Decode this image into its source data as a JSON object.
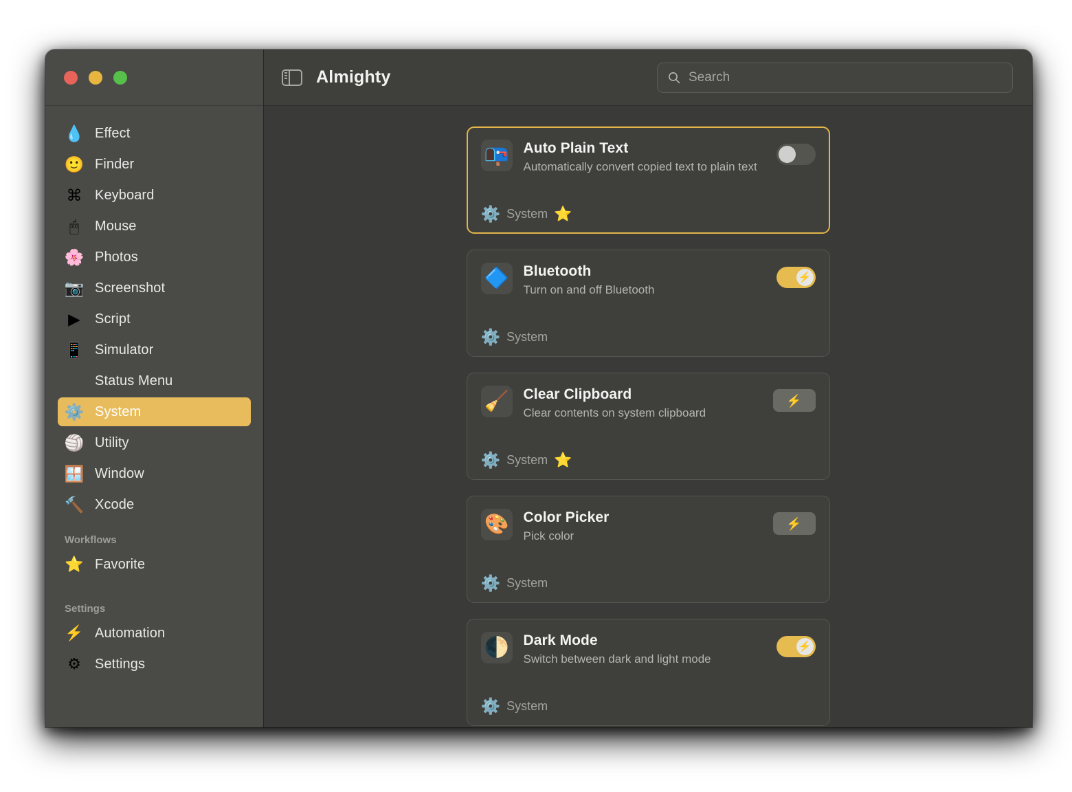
{
  "window": {
    "traffic_lights": [
      "close",
      "minimize",
      "zoom"
    ]
  },
  "toolbar": {
    "sidebar_toggle_name": "sidebar-toggle-icon",
    "title": "Almighty",
    "search": {
      "value": "",
      "placeholder": "Search"
    }
  },
  "sidebar": {
    "items": [
      {
        "label": "Effect",
        "icon": "💧",
        "selected": false
      },
      {
        "label": "Finder",
        "icon": "🙂",
        "selected": false
      },
      {
        "label": "Keyboard",
        "icon": "⌘",
        "selected": false
      },
      {
        "label": "Mouse",
        "icon": "🖱",
        "selected": false
      },
      {
        "label": "Photos",
        "icon": "🌸",
        "selected": false
      },
      {
        "label": "Screenshot",
        "icon": "📷",
        "selected": false
      },
      {
        "label": "Script",
        "icon": "▶",
        "selected": false
      },
      {
        "label": "Simulator",
        "icon": "📱",
        "selected": false
      },
      {
        "label": "Status Menu",
        "icon": "",
        "selected": false
      },
      {
        "label": "System",
        "icon": "⚙️",
        "selected": true
      },
      {
        "label": "Utility",
        "icon": "🏐",
        "selected": false
      },
      {
        "label": "Window",
        "icon": "🪟",
        "selected": false
      },
      {
        "label": "Xcode",
        "icon": "🔨",
        "selected": false
      }
    ],
    "sections": [
      {
        "title": "Workflows",
        "items": [
          {
            "label": "Favorite",
            "icon": "⭐"
          }
        ]
      },
      {
        "title": "Settings",
        "items": [
          {
            "label": "Automation",
            "icon": "⚡"
          },
          {
            "label": "Settings",
            "icon": "⚙"
          }
        ]
      }
    ]
  },
  "main": {
    "cards": [
      {
        "title": "Auto Plain Text",
        "subtitle": "Automatically convert copied text to plain text",
        "icon": "📭",
        "control": "toggle",
        "toggle_on": false,
        "selected": true,
        "category_icon": "⚙️",
        "category": "System",
        "favorite": true,
        "favorite_icon": "⭐"
      },
      {
        "title": "Bluetooth",
        "subtitle": "Turn on and off Bluetooth",
        "icon": "🔷",
        "control": "toggle",
        "toggle_on": true,
        "selected": false,
        "category_icon": "⚙️",
        "category": "System",
        "favorite": false,
        "favorite_icon": ""
      },
      {
        "title": "Clear Clipboard",
        "subtitle": "Clear contents on system clipboard",
        "icon": "🧹",
        "control": "action",
        "toggle_on": false,
        "selected": false,
        "category_icon": "⚙️",
        "category": "System",
        "favorite": true,
        "favorite_icon": "⭐"
      },
      {
        "title": "Color Picker",
        "subtitle": "Pick color",
        "icon": "🎨",
        "control": "action",
        "toggle_on": false,
        "selected": false,
        "category_icon": "⚙️",
        "category": "System",
        "favorite": false,
        "favorite_icon": ""
      },
      {
        "title": "Dark Mode",
        "subtitle": "Switch between dark and light mode",
        "icon": "🌓",
        "control": "toggle",
        "toggle_on": true,
        "selected": false,
        "category_icon": "⚙️",
        "category": "System",
        "favorite": false,
        "favorite_icon": ""
      }
    ],
    "action_icon": "⚡",
    "knob_icon": "⚡"
  },
  "colors": {
    "accent": "#e8bc5c",
    "selected_card_border": "#e3b54a",
    "sidebar_bg": "#4a4a47",
    "content_bg": "#3a3a38",
    "card_bg": "#3f3f3c"
  }
}
